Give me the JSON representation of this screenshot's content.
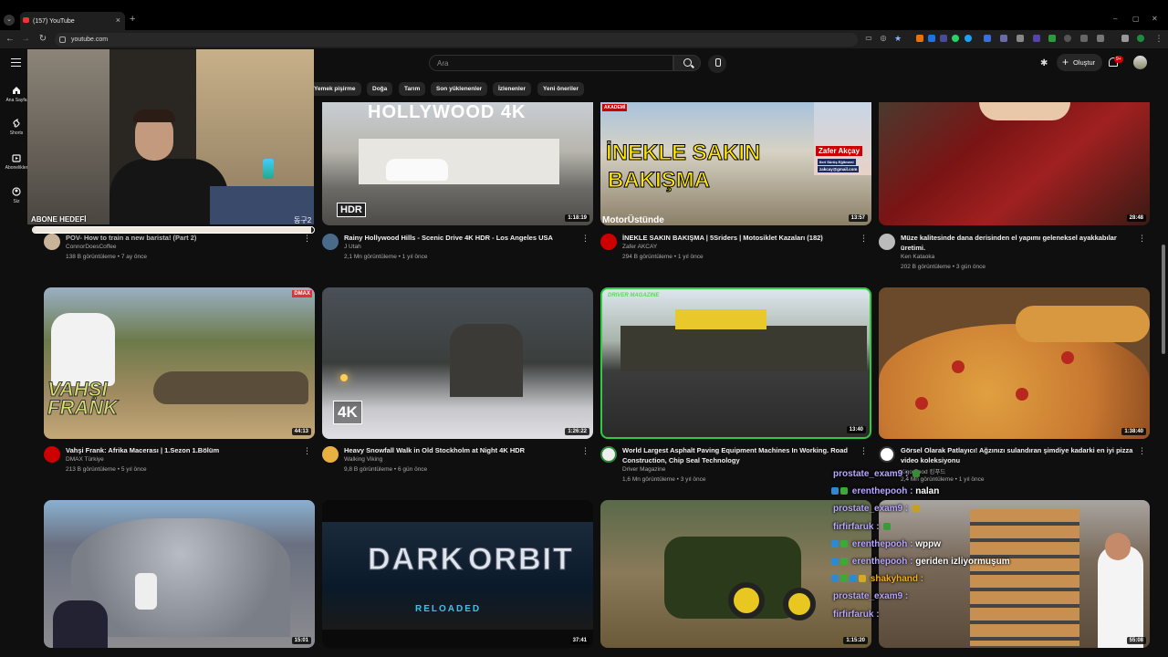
{
  "browser": {
    "tab_title": "(157) YouTube",
    "tab_close": "×",
    "new_tab": "+",
    "url": "youtube.com",
    "win_min": "–",
    "win_max": "▢",
    "win_close": "✕"
  },
  "header": {
    "search_placeholder": "Ara",
    "create_label": "Oluştur",
    "notif_badge": "9+"
  },
  "sidebar": {
    "items": [
      {
        "label": "Ana Sayfa",
        "icon": "home-icon"
      },
      {
        "label": "Shorts",
        "icon": "shorts-icon"
      },
      {
        "label": "Abonelikler",
        "icon": "subscriptions-icon"
      },
      {
        "label": "Siz",
        "icon": "you-icon"
      }
    ]
  },
  "chips": [
    "Yemek pişirme",
    "Doğa",
    "Tarım",
    "Son yüklenenler",
    "İzlenenler",
    "Yeni öneriler"
  ],
  "overlay": {
    "goal_label": "ABONE HEDEFİ",
    "goal_count": "동구2",
    "goal_progress": 0.99
  },
  "videos": [
    {
      "title": "POV- How to train a new barista! (Part 2)",
      "channel": "ConnorDoesCoffee",
      "stats": "138 B görüntüleme • 7 ay önce",
      "duration": "",
      "verified": false
    },
    {
      "title": "Rainy Hollywood Hills - Scenic Drive 4K HDR - Los Angeles USA",
      "channel": "J Utah",
      "stats": "2,1 Mn görüntüleme • 1 yıl önce",
      "duration": "1:18:19",
      "verified": true,
      "thumb_text": "HOLLYWOOD 4K",
      "thumb_badge": "HDR"
    },
    {
      "title": "İNEKLE SAKIN BAKIŞMA | 5Sriders | Motosiklet Kazaları (182)",
      "channel": "Zafer AKCAY",
      "stats": "294 B görüntüleme • 1 yıl önce",
      "duration": "13:57",
      "verified": true,
      "thumb_text1": "İNEKLE SAKIN",
      "thumb_text2": "BAKIŞMA",
      "thumb_name": "Zafer Akçay",
      "thumb_sub": "Ileri Sürüş Eğitmeni",
      "thumb_mail": "zakcay@gmail.com",
      "thumb_logo": "MotorÜstünde",
      "thumb_corner": "AKADEMİ"
    },
    {
      "title": "Müze kalitesinde dana derisinden el yapımı geleneksel ayakkabılar üretimi.",
      "channel": "Ken Kataoka",
      "stats": "202 B görüntüleme • 3 gün önce",
      "duration": "28:48",
      "verified": false
    },
    {
      "title": "Vahşi Frank: Afrika Macerası | 1.Sezon 1.Bölüm",
      "channel": "DMAX Türkiye",
      "stats": "213 B görüntüleme • 5 yıl önce",
      "duration": "44:13",
      "verified": true,
      "thumb_text": "VAHŞI FRANK",
      "thumb_badge": "DMAX"
    },
    {
      "title": "Heavy Snowfall Walk in Old Stockholm at Night 4K HDR",
      "channel": "Walking Viking",
      "stats": "9,8 B görüntüleme • 6 gün önce",
      "duration": "1:26:22",
      "verified": false,
      "thumb_badge": "4K"
    },
    {
      "title": "World Largest Asphalt Paving Equipment Machines In Working. Road Construction, Chip Seal Technology",
      "channel": "Driver Magazine",
      "stats": "1,6 Mn görüntüleme • 3 yıl önce",
      "duration": "13:40",
      "verified": false,
      "thumb_corner": "DRIVER MAGAZINE"
    },
    {
      "title": "Görsel Olarak Patlayıcı! Ağzınızı sulandıran şimdiye kadarki en iyi pizza video koleksiyonu",
      "channel": "Kigo Food 킹푸드",
      "stats": "2,4 Mn görüntüleme • 1 yıl önce",
      "duration": "1:38:40",
      "verified": false
    },
    {
      "title": "",
      "channel": "",
      "stats": "",
      "duration": "15:01"
    },
    {
      "title": "",
      "channel": "",
      "stats": "",
      "duration": "37:41",
      "thumb_text1": "DARK",
      "thumb_text2": "ORBIT",
      "thumb_text3": "RELOADED"
    },
    {
      "title": "",
      "channel": "",
      "stats": "",
      "duration": "1:15:20"
    },
    {
      "title": "",
      "channel": "",
      "stats": "",
      "duration": "55:08"
    }
  ],
  "chat": [
    {
      "user": "prostate_exam9 :",
      "msg": ""
    },
    {
      "user": "erenthepooh :",
      "msg": "nalan"
    },
    {
      "user": "prostate_exam9 :",
      "msg": ""
    },
    {
      "user": "firfirfaruk :",
      "msg": ""
    },
    {
      "user": "erenthepooh :",
      "msg": "wppw"
    },
    {
      "user": "erenthepooh :",
      "msg": "geriden izliyormuşum"
    },
    {
      "user": "shakyhand :",
      "msg": ""
    },
    {
      "user": "prostate_exam9 :",
      "msg": ""
    },
    {
      "user": "firfirfaruk :",
      "msg": ""
    }
  ],
  "colors": {
    "accent": "#cc0000",
    "chat_user": "#b8a6ff",
    "highlight_border": "#2ecc40"
  }
}
